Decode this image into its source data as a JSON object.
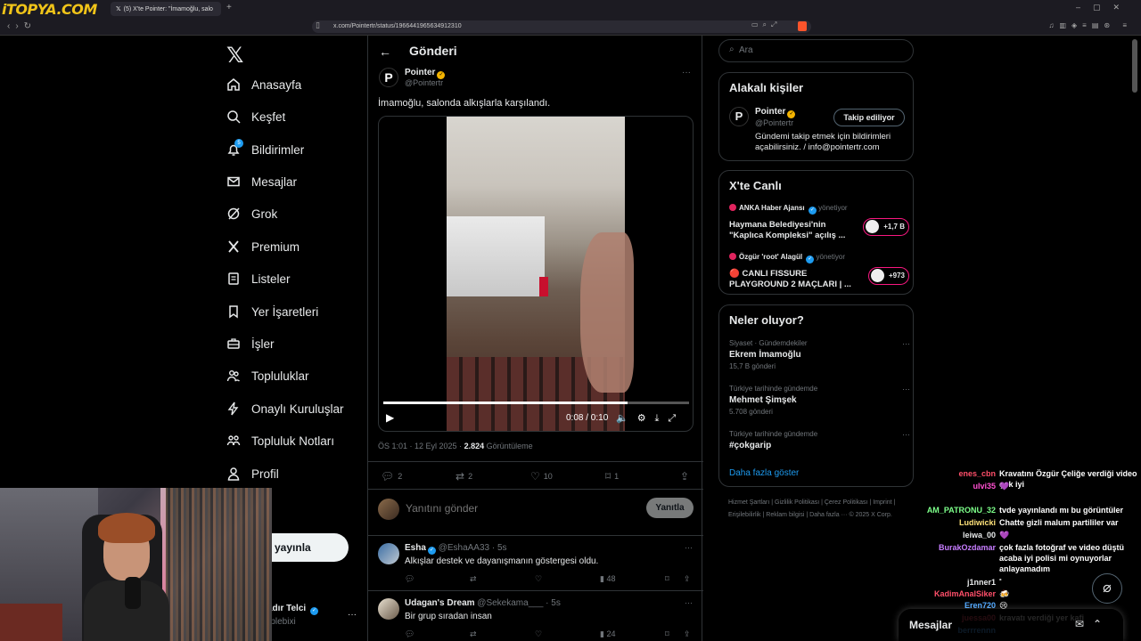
{
  "browser": {
    "watermark": "iTOPYA.COM",
    "tab_title": "(5) X'te Pointer: \"İmamoğlu, salo",
    "url": "x.com/Pointertr/status/1966441965634912310"
  },
  "nav": {
    "items": [
      {
        "label": "Anasayfa",
        "icon": "home-icon"
      },
      {
        "label": "Keşfet",
        "icon": "search-icon"
      },
      {
        "label": "Bildirimler",
        "icon": "bell-icon"
      },
      {
        "label": "Mesajlar",
        "icon": "mail-icon"
      },
      {
        "label": "Grok",
        "icon": "grok-icon"
      },
      {
        "label": "Premium",
        "icon": "x-icon"
      },
      {
        "label": "Listeler",
        "icon": "list-icon"
      },
      {
        "label": "Yer İşaretleri",
        "icon": "bookmark-icon"
      },
      {
        "label": "İşler",
        "icon": "briefcase-icon"
      },
      {
        "label": "Topluluklar",
        "icon": "people-icon"
      },
      {
        "label": "Onaylı Kuruluşlar",
        "icon": "lightning-icon"
      },
      {
        "label": "Topluluk Notları",
        "icon": "notes-icon"
      },
      {
        "label": "Profil",
        "icon": "person-icon"
      },
      {
        "label": "a fazla",
        "icon": ""
      }
    ],
    "notif_count": "5",
    "post_button": "eri yayınla",
    "profile_name": "adır Telci",
    "profile_handle": "rplebixi"
  },
  "header": {
    "title": "Gönderi"
  },
  "post": {
    "author": "Pointer",
    "handle": "@Pointertr",
    "text": "İmamoğlu, salonda alkışlarla karşılandı.",
    "video": {
      "time": "0:08 / 0:10",
      "progress": 0.8
    },
    "meta_time": "ÖS 1:01 · 12 Eyl 2025 · ",
    "views": "2.824",
    "views_label": " Görüntüleme",
    "replies": "2",
    "reposts": "2",
    "likes": "10",
    "bookmarks": "1"
  },
  "reply_box": {
    "placeholder": "Yanıtını gönder",
    "button": "Yanıtla"
  },
  "replies": [
    {
      "name": "Esha",
      "handle": "@EshaAA33 · 5s",
      "text": "Alkışlar destek ve dayanışmanın göstergesi oldu.",
      "views": "48"
    },
    {
      "name": "Udagan's Dream",
      "handle": "@Sekekama___ · 5s",
      "text": "Bir grup sıradan insan",
      "views": "24"
    }
  ],
  "right": {
    "search_placeholder": "Ara",
    "related_title": "Alakalı kişiler",
    "related": {
      "name": "Pointer",
      "handle": "@Pointertr",
      "button": "Takip ediliyor",
      "bio": "Gündemi takip etmek için bildirimleri açabilirsiniz. / info@pointertr.com"
    },
    "live_title": "X'te Canlı",
    "live": [
      {
        "host": "ANKA Haber Ajansı",
        "sub": "yönetiyor",
        "title": "Haymana Belediyesi'nin \"Kaplıca Kompleksi\" açılış ...",
        "count": "+1,7 B"
      },
      {
        "host": "Özgür 'root' Alagül",
        "sub": "yönetiyor",
        "title": "🔴 CANLI FISSURE PLAYGROUND 2 MAÇLARI | ...",
        "count": "+973"
      }
    ],
    "trends_title": "Neler oluyor?",
    "trends": [
      {
        "context": "Siyaset · Gündemdekiler",
        "name": "Ekrem İmamoğlu",
        "count": "15,7 B gönderi"
      },
      {
        "context": "Türkiye tarihinde gündemde",
        "name": "Mehmet Şimşek",
        "count": "5.708 gönderi"
      },
      {
        "context": "Türkiye tarihinde gündemde",
        "name": "#çokgarip",
        "count": ""
      }
    ],
    "show_more": "Daha fazla göster",
    "footer": "Hizmet Şartları  |  Gizlilik Politikası  |  Çerez Politikası  |  Imprint  |  Erişilebilirlik  |  Reklam bilgisi  |  Daha fazla ···  © 2025 X Corp."
  },
  "chat": [
    {
      "user": "enes_cbn",
      "color": "#ff4f6a",
      "msg": "Kravatını Özgür Çeliğe verdiği video çok iyi"
    },
    {
      "user": "ulvi35",
      "color": "#ff4fd0",
      "msg": "💜"
    },
    {
      "user": "AM_PATRONU_32",
      "color": "#7dff8a",
      "msg": "tvde yayınlandı mı bu görüntüler"
    },
    {
      "user": "Ludiwicki",
      "color": "#ffe27a",
      "msg": "Chatte gizli malum partililer var"
    },
    {
      "user": "leiwa_00",
      "color": "#e7e9ea",
      "msg": "💜"
    },
    {
      "user": "BurakOzdamar",
      "color": "#c77dff",
      "msg": "çok fazla fotoğraf ve video düştü acaba iyi polisi mi oynuyorlar anlayamadım"
    },
    {
      "user": "j1nner1",
      "color": "#e7e9ea",
      "msg": "˚"
    },
    {
      "user": "KadimAnalSiker",
      "color": "#ff4f6a",
      "msg": "🍻"
    },
    {
      "user": "Eren720",
      "color": "#4fa8ff",
      "msg": "😢"
    },
    {
      "user": "juessa00",
      "color": "#ff4f6a",
      "msg": "kravatı verdiği yer kafi"
    },
    {
      "user": "berrrennn",
      "color": "#4fa8ff",
      "msg": ""
    }
  ],
  "messages_drawer": {
    "title": "Mesajlar"
  }
}
